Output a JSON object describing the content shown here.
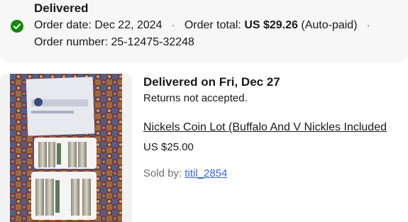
{
  "order_status": {
    "title": "Delivered",
    "status_icon": "check-circle-icon",
    "status_color": "#118a00",
    "order_date_label": "Order date:",
    "order_date": "Dec 22, 2024",
    "separator": "·",
    "order_total_label": "Order total:",
    "order_total": "US $29.26",
    "payment_note": "(Auto-paid)",
    "order_number_label": "Order number:",
    "order_number": "25-12475-32248"
  },
  "item": {
    "image_icon": "coin-rolls-photo",
    "delivery_text": "Delivered on Fri, Dec 27",
    "returns_text": "Returns not accepted.",
    "title": "Nickels Coin Lot (Buffalo And V Nickles Included",
    "price": "US $25.00",
    "seller_label": "Sold by:",
    "seller_name": "titil_2854",
    "link_color": "#3665f3"
  }
}
